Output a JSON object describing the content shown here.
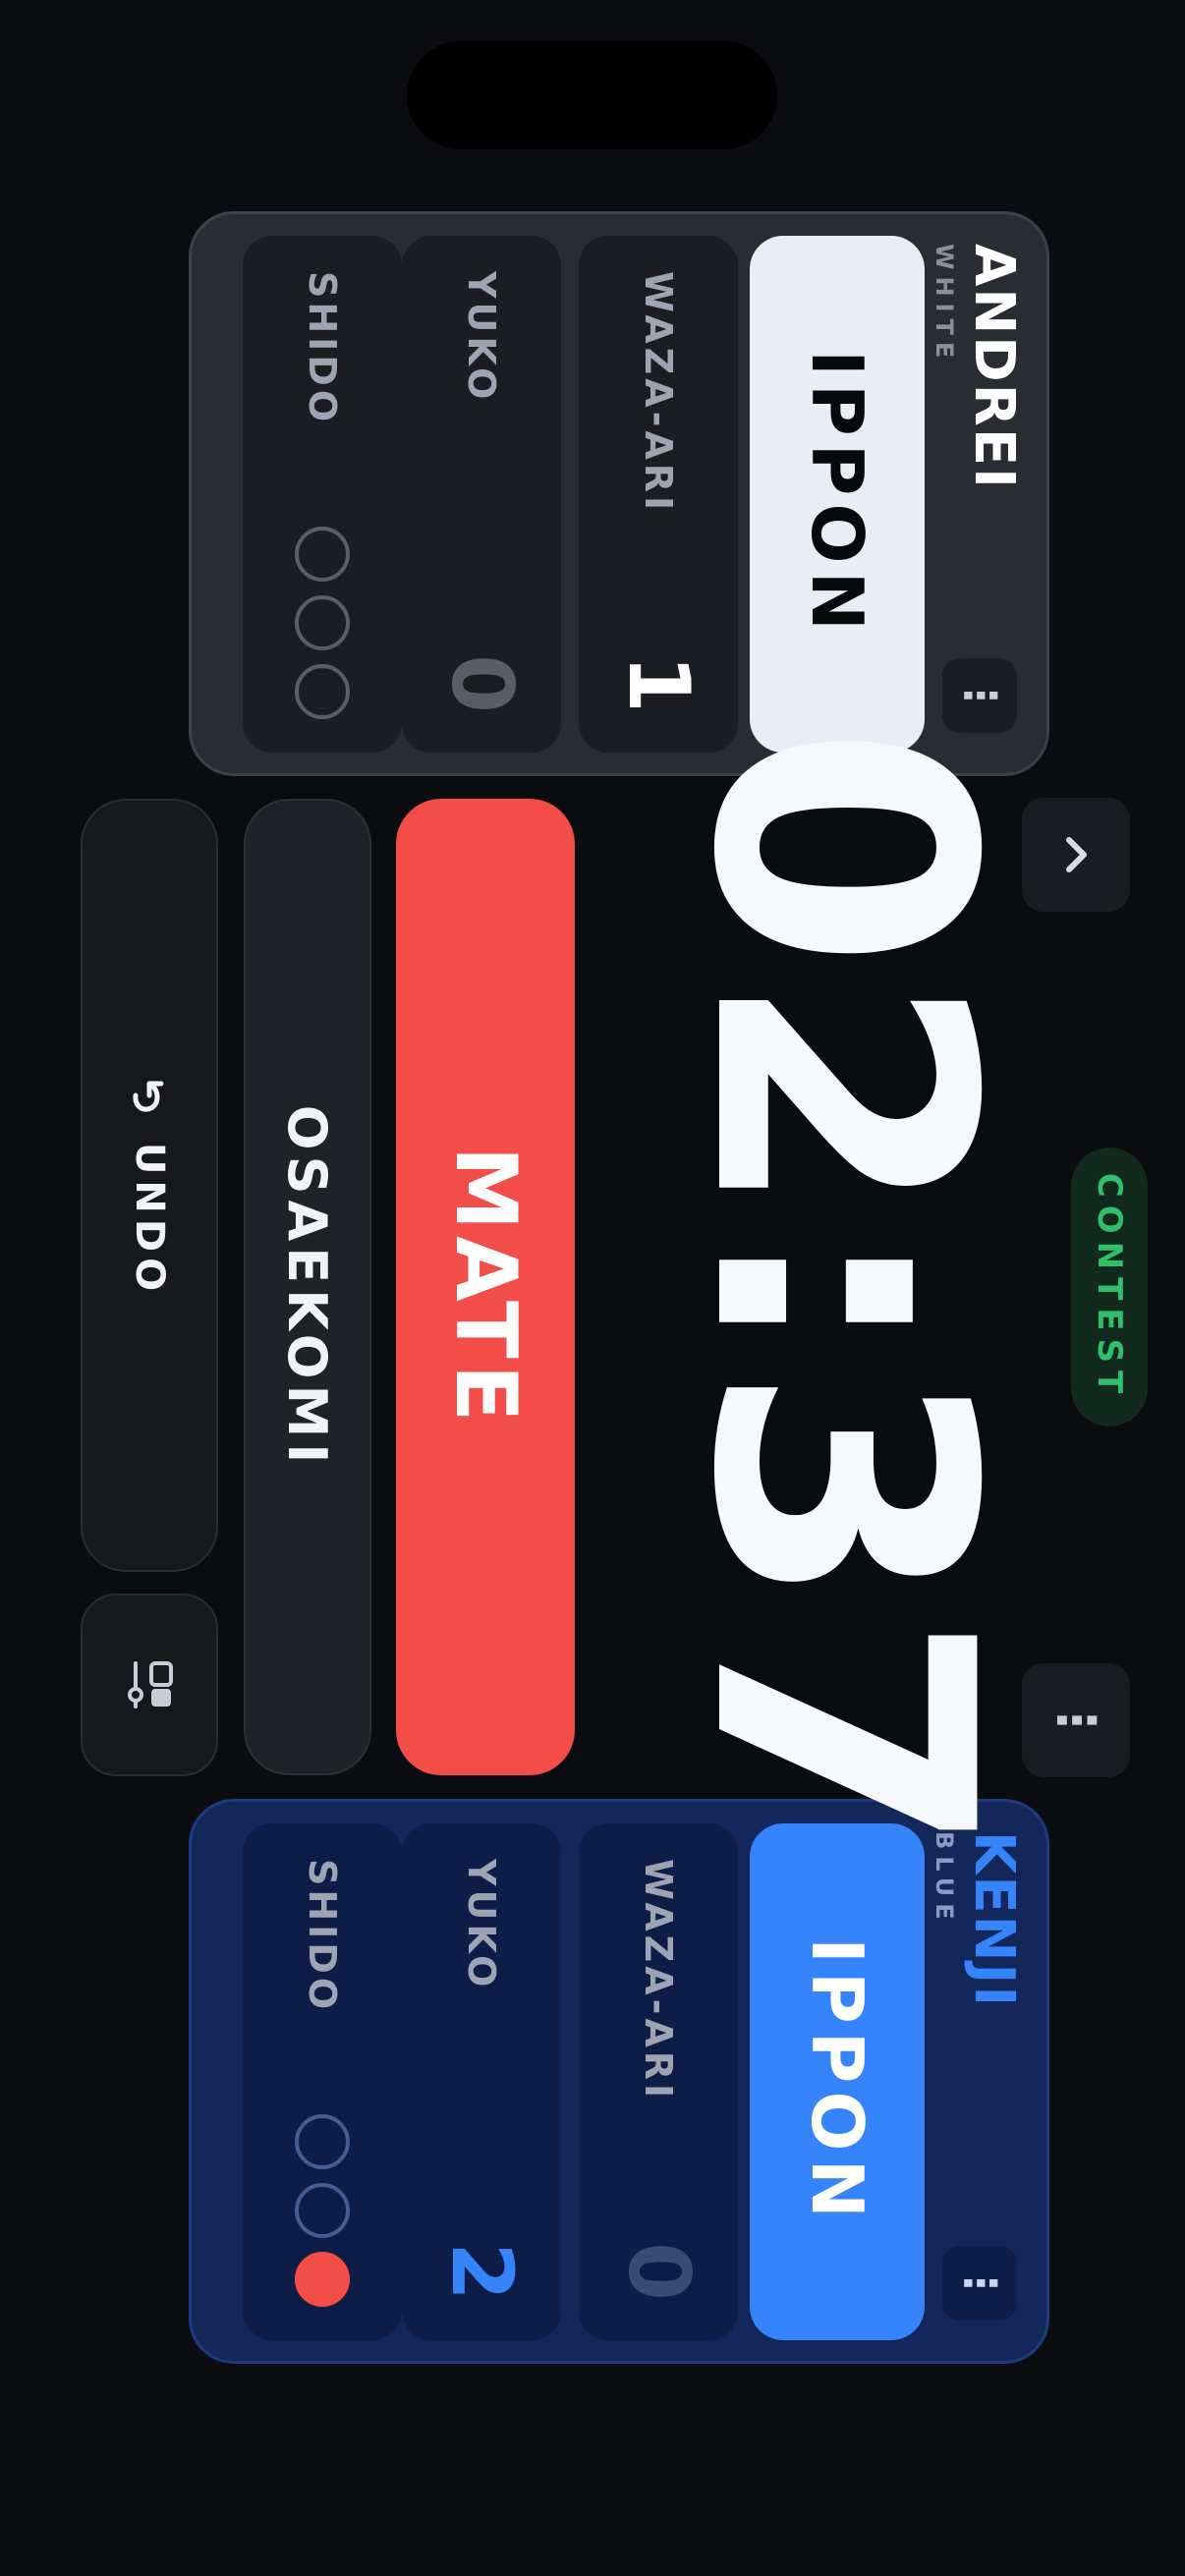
{
  "fighters": {
    "white": {
      "name": "ANDREI",
      "color_label": "WHITE",
      "ippon_label": "IPPON",
      "waza_ari_label": "WAZA-ARI",
      "waza_ari_value": "1",
      "yuko_label": "YUKO",
      "yuko_value": "0",
      "shido_label": "SHIDO",
      "shido_count": 0,
      "shido_max": 3,
      "name_color": "#ffffff",
      "menu_icon": "more-vertical-icon"
    },
    "blue": {
      "name": "KENJI",
      "color_label": "BLUE",
      "ippon_label": "IPPON",
      "waza_ari_label": "WAZA-ARI",
      "waza_ari_value": "0",
      "yuko_label": "YUKO",
      "yuko_value": "2",
      "shido_label": "SHIDO",
      "shido_count": 1,
      "shido_max": 3,
      "name_color": "#3584fc",
      "menu_icon": "more-vertical-icon"
    }
  },
  "match": {
    "timer": "02:37",
    "status": "CONTEST",
    "status_color": "#2fc06a"
  },
  "controls": {
    "mate_label": "MATE",
    "osaekomi_label": "OSAEKOMI",
    "undo_label": "UNDO",
    "undo_icon": "undo-icon",
    "settings_icon": "layout-settings-icon",
    "top_icon": "chevron-up-icon",
    "more_icon": "more-vertical-icon"
  },
  "colors": {
    "background": "#0b0c10",
    "mate": "#f24d48",
    "blue_accent": "#3584fc",
    "penalty": "#f24d48"
  }
}
